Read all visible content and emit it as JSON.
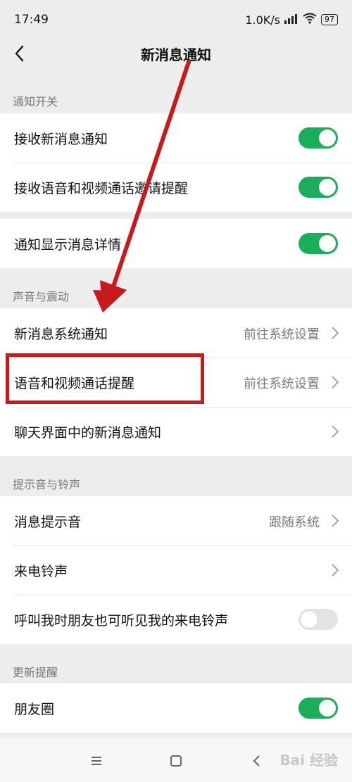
{
  "status": {
    "time": "17:49",
    "network": "1.0K/s",
    "battery": "97"
  },
  "header": {
    "title": "新消息通知"
  },
  "sections": {
    "notify_switch": "通知开关",
    "sound_vibration": "声音与震动",
    "tones": "提示音与铃声",
    "updates": "更新提醒"
  },
  "rows": {
    "receive_new": "接收新消息通知",
    "receive_av": "接收语音和视频通话邀请提醒",
    "show_detail": "通知显示消息详情",
    "new_msg_system": "新消息系统通知",
    "av_call_remind": "语音和视频通话提醒",
    "chat_new_msg": "聊天界面中的新消息通知",
    "msg_tone": "消息提示音",
    "ringtone": "来电铃声",
    "friends_hear": "呼叫我时朋友也可听见我的来电铃声",
    "moments": "朋友圈"
  },
  "values": {
    "goto_system": "前往系统设置",
    "follow_system": "跟随系统"
  },
  "toggles": {
    "receive_new": true,
    "receive_av": true,
    "show_detail": true,
    "friends_hear": false,
    "moments": true
  },
  "watermark": "Bai 经验",
  "colors": {
    "toggle_on": "#1aad5a",
    "annotation": "#c8191d",
    "background": "#ededed"
  }
}
